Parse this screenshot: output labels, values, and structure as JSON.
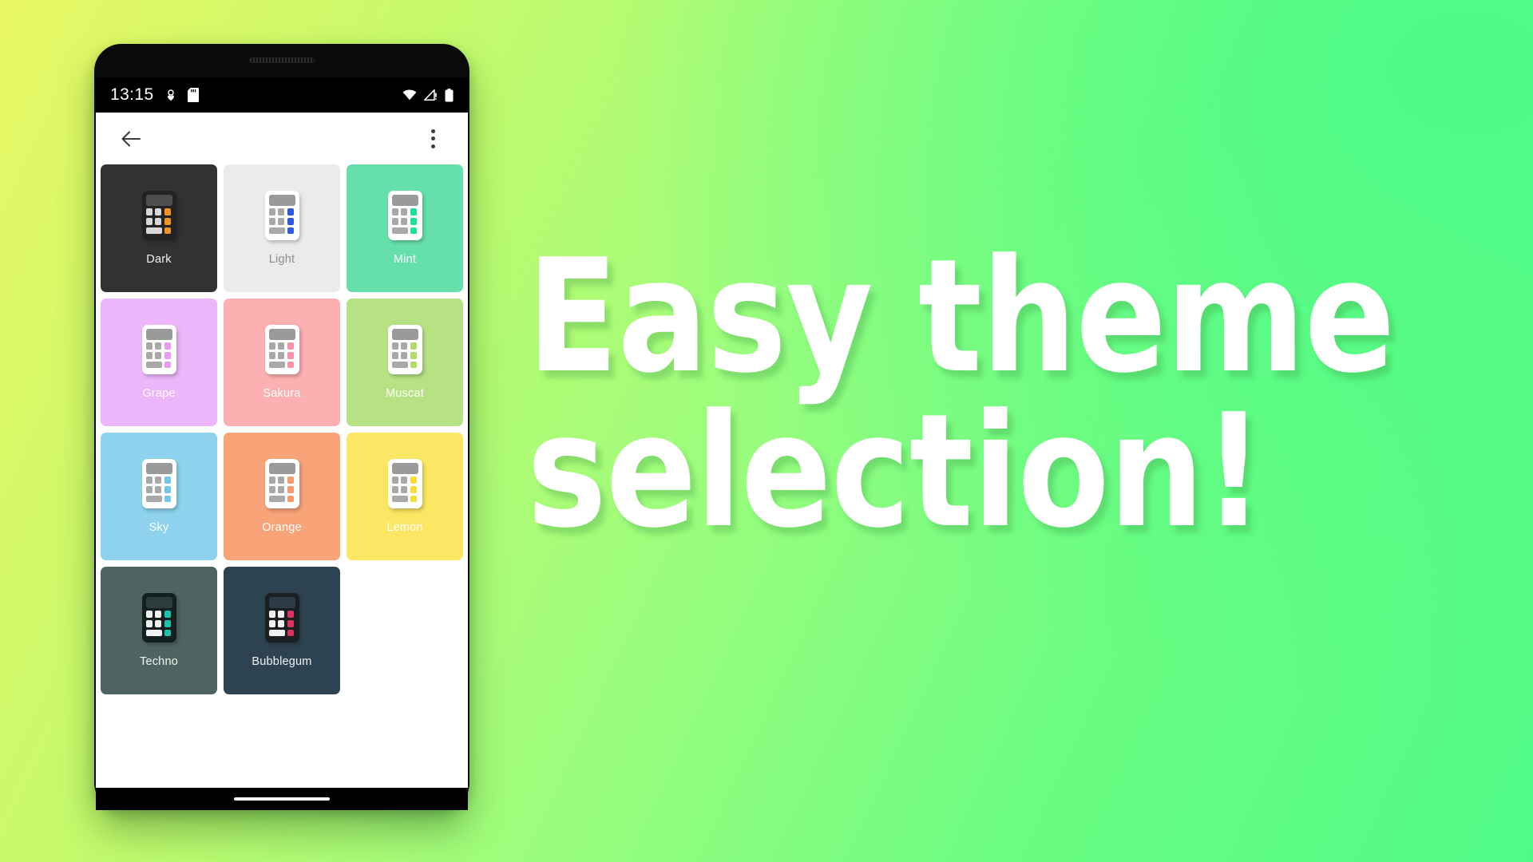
{
  "background": {
    "gradient_from": "#e9f764",
    "gradient_to": "#4ffb86"
  },
  "headline": {
    "text": "Easy theme\nselection!",
    "color": "#ffffff"
  },
  "phone": {
    "status_bar": {
      "time": "13:15",
      "left_icons": [
        "heart-circle-icon",
        "sd-card-icon"
      ],
      "right_icons": [
        "wifi-icon",
        "cellular-signal-alert-icon",
        "battery-full-icon"
      ],
      "background": "#000000"
    },
    "app_bar": {
      "back_icon": "arrow-left-icon",
      "overflow_icon": "more-vertical-icon"
    },
    "gesture_nav": {
      "pill": "home-gesture-pill"
    }
  },
  "themes": [
    {
      "name": "Dark",
      "tile_bg": "#323232",
      "label_color": "#f2f2f2",
      "calc_body": "#232323",
      "calc_screen": "#4e4e4e",
      "calc_key": "#d8d8d8",
      "calc_accent": "#f79421"
    },
    {
      "name": "Light",
      "tile_bg": "#ebebeb",
      "label_color": "#8c8c8c",
      "calc_body": "#ffffff",
      "calc_screen": "#9a9a9a",
      "calc_key": "#a8a8a8",
      "calc_accent": "#2f59e0"
    },
    {
      "name": "Mint",
      "tile_bg": "#66e0ab",
      "label_color": "#ffffff",
      "calc_body": "#ffffff",
      "calc_screen": "#9a9a9a",
      "calc_key": "#a8a8a8",
      "calc_accent": "#1fe093"
    },
    {
      "name": "Grape",
      "tile_bg": "#edb6fb",
      "label_color": "#ffffff",
      "calc_body": "#ffffff",
      "calc_screen": "#9a9a9a",
      "calc_key": "#a8a8a8",
      "calc_accent": "#e79bf2"
    },
    {
      "name": "Sakura",
      "tile_bg": "#fcb0b1",
      "label_color": "#ffffff",
      "calc_body": "#ffffff",
      "calc_screen": "#9a9a9a",
      "calc_key": "#a8a8a8",
      "calc_accent": "#f793a5"
    },
    {
      "name": "Muscat",
      "tile_bg": "#b7e283",
      "label_color": "#ffffff",
      "calc_body": "#ffffff",
      "calc_screen": "#9a9a9a",
      "calc_key": "#a8a8a8",
      "calc_accent": "#b4da6b"
    },
    {
      "name": "Sky",
      "tile_bg": "#8ed2ed",
      "label_color": "#ffffff",
      "calc_body": "#ffffff",
      "calc_screen": "#9a9a9a",
      "calc_key": "#a8a8a8",
      "calc_accent": "#73c6ea"
    },
    {
      "name": "Orange",
      "tile_bg": "#f9a378",
      "label_color": "#ffffff",
      "calc_body": "#ffffff",
      "calc_screen": "#9a9a9a",
      "calc_key": "#a8a8a8",
      "calc_accent": "#f79a6c"
    },
    {
      "name": "Lemon",
      "tile_bg": "#fbe763",
      "label_color": "#ffffff",
      "calc_body": "#ffffff",
      "calc_screen": "#9a9a9a",
      "calc_key": "#a8a8a8",
      "calc_accent": "#f6dc3c"
    },
    {
      "name": "Techno",
      "tile_bg": "#4d6460",
      "label_color": "#f2f2f2",
      "calc_body": "#14201f",
      "calc_screen": "#2b3c3a",
      "calc_key": "#f2f2f2",
      "calc_accent": "#16c5ab"
    },
    {
      "name": "Bubblegum",
      "tile_bg": "#2e4351",
      "label_color": "#f2f2f2",
      "calc_body": "#1b1f22",
      "calc_screen": "#2e3b45",
      "calc_key": "#f2f2f2",
      "calc_accent": "#d93361"
    }
  ]
}
